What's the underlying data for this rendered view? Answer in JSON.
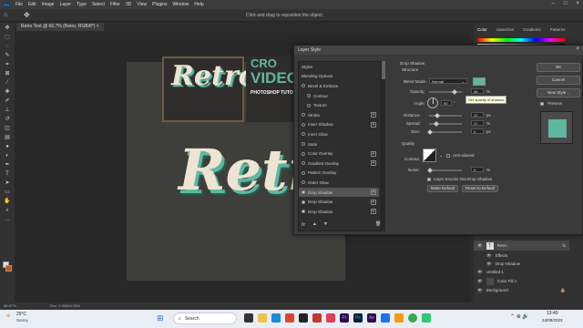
{
  "menu": {
    "items": [
      "File",
      "Edit",
      "Image",
      "Layer",
      "Type",
      "Select",
      "Filter",
      "3D",
      "View",
      "Plugins",
      "Window",
      "Help"
    ],
    "logo": "Ps"
  },
  "optionsbar": {
    "hint": "Click and drag to reposition the object."
  },
  "document": {
    "tab": "Retro Text @ 66.7% (Retro, RGB/8*) ×",
    "zoom": "66.67%",
    "doc_size": "Doc: 2.99M/4.39M",
    "canvas_text": "Retro",
    "thumb_text": "Retro",
    "card_title": "VIDEO",
    "card_partial_top": "CRO",
    "card_sub": "PHOTOSHOP TUTORI"
  },
  "right_panel": {
    "tabs": [
      "Color",
      "Swatches",
      "Gradients",
      "Patterns"
    ],
    "layers": [
      {
        "name": "Retro",
        "fx": "fx"
      },
      {
        "name": "Effects",
        "fx": ""
      },
      {
        "name": "Drop Shadow",
        "fx": ""
      },
      {
        "name": "Untitled-1",
        "fx": ""
      },
      {
        "name": "Color Fill 1",
        "fx": ""
      },
      {
        "name": "Background",
        "fx": ""
      }
    ]
  },
  "dialog": {
    "title": "Layer Style",
    "styles_header": "Styles",
    "styles": [
      {
        "label": "Blending Options",
        "check": false,
        "plus": false,
        "sel": false
      },
      {
        "label": "Bevel & Emboss",
        "check": true,
        "plus": false,
        "sel": false
      },
      {
        "label": "Contour",
        "check": true,
        "plus": false,
        "sel": false
      },
      {
        "label": "Texture",
        "check": true,
        "plus": false,
        "sel": false
      },
      {
        "label": "Stroke",
        "check": true,
        "plus": true,
        "sel": false
      },
      {
        "label": "Inner Shadow",
        "check": true,
        "plus": true,
        "sel": false
      },
      {
        "label": "Inner Glow",
        "check": true,
        "plus": false,
        "sel": false
      },
      {
        "label": "Satin",
        "check": true,
        "plus": false,
        "sel": false
      },
      {
        "label": "Color Overlay",
        "check": true,
        "plus": true,
        "sel": false
      },
      {
        "label": "Gradient Overlay",
        "check": true,
        "plus": true,
        "sel": false
      },
      {
        "label": "Pattern Overlay",
        "check": true,
        "plus": false,
        "sel": false
      },
      {
        "label": "Outer Glow",
        "check": true,
        "plus": false,
        "sel": false
      },
      {
        "label": "Drop Shadow",
        "check": true,
        "plus": true,
        "sel": true
      },
      {
        "label": "Drop Shadow",
        "check": true,
        "plus": true,
        "sel": false
      },
      {
        "label": "Drop Shadow",
        "check": true,
        "plus": true,
        "sel": false
      }
    ],
    "section_title": "Drop Shadow",
    "structure_title": "Structure",
    "blend_mode_label": "Blend Mode:",
    "blend_mode": "Normal",
    "opacity_label": "Opacity:",
    "opacity": "48",
    "tooltip": "Set opacity of shadow",
    "angle_label": "Angle:",
    "angle": "90",
    "distance_label": "Distance:",
    "distance": "12",
    "spread_label": "Spread:",
    "spread": "17",
    "size_label": "Size:",
    "size": "0",
    "px": "px",
    "pct": "%",
    "deg": "°",
    "quality_title": "Quality",
    "contour_label": "Contour:",
    "antialiased": "Anti-aliased",
    "noise_label": "Noise:",
    "noise": "0",
    "knockout_label": "Layer Knocks Out Drop Shadow",
    "make_default": "Make Default",
    "reset_default": "Reset to Default",
    "ok": "OK",
    "cancel": "Cancel",
    "new_style": "New Style...",
    "preview": "Preview",
    "fx_bottom": "fx",
    "shadow_color": "#5fb7a0"
  },
  "taskbar": {
    "weather_temp": "29°C",
    "weather_desc": "Sunny",
    "search": "Search",
    "time": "13:40",
    "date": "24/09/2023"
  }
}
